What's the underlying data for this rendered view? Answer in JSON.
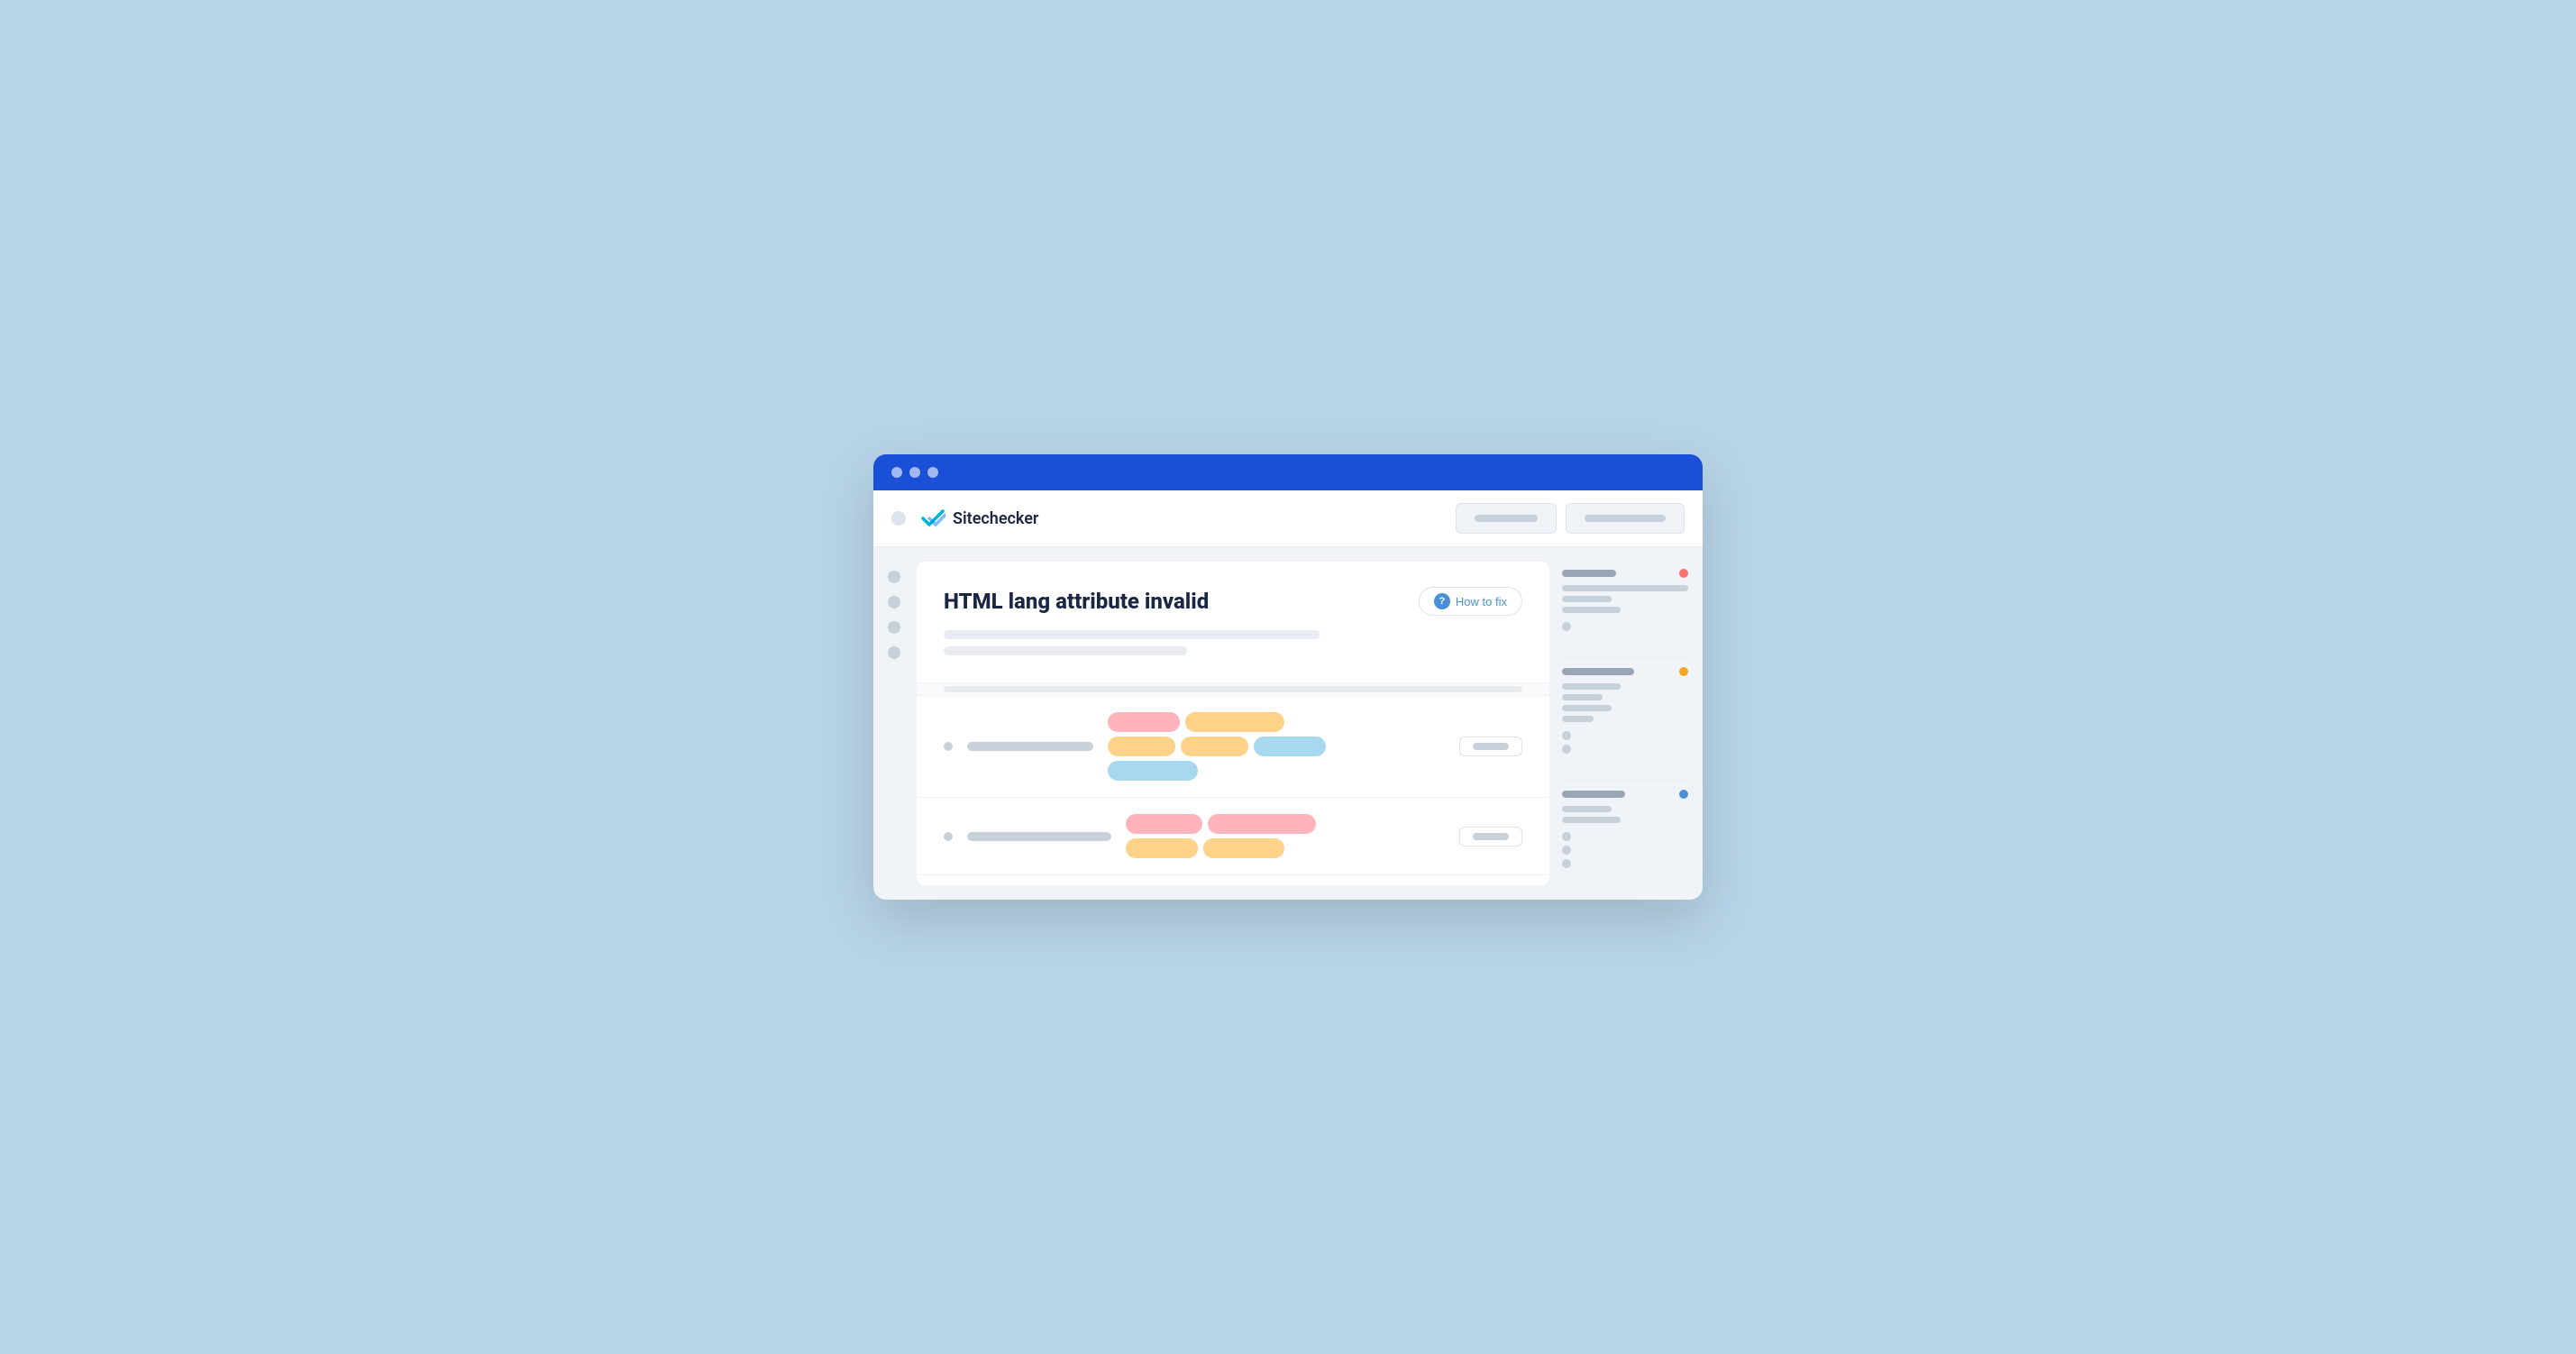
{
  "browser": {
    "dots": [
      "dot1",
      "dot2",
      "dot3"
    ],
    "titlebar_color": "#1a4fd8"
  },
  "navbar": {
    "logo_text": "Sitechecker",
    "button1_label": "",
    "button2_label": ""
  },
  "content": {
    "page_title": "HTML lang attribute invalid",
    "how_to_fix_label": "How to fix",
    "desc_line1": "",
    "desc_line2": "",
    "rows": [
      {
        "id": "row1",
        "tags": [
          {
            "color": "pink",
            "label": ""
          },
          {
            "color": "orange",
            "label": ""
          },
          {
            "color": "orange",
            "label": ""
          },
          {
            "color": "orange",
            "label": ""
          },
          {
            "color": "blue",
            "label": ""
          },
          {
            "color": "blue",
            "label": ""
          }
        ]
      },
      {
        "id": "row2",
        "tags": [
          {
            "color": "pink",
            "label": ""
          },
          {
            "color": "pink",
            "label": ""
          },
          {
            "color": "orange",
            "label": ""
          },
          {
            "color": "orange",
            "label": ""
          }
        ]
      }
    ]
  },
  "sidebar_right": {
    "sections": [
      {
        "label": "section1",
        "dot_color": "red",
        "bars": [
          "w60",
          "w80",
          "w50",
          "w70"
        ]
      },
      {
        "label": "section2",
        "dot_color": "orange",
        "bars": [
          "w80",
          "w50",
          "w60",
          "w40"
        ]
      },
      {
        "label": "section3",
        "dot_color": "blue",
        "bars": [
          "w70",
          "w45",
          "w55"
        ]
      }
    ]
  }
}
